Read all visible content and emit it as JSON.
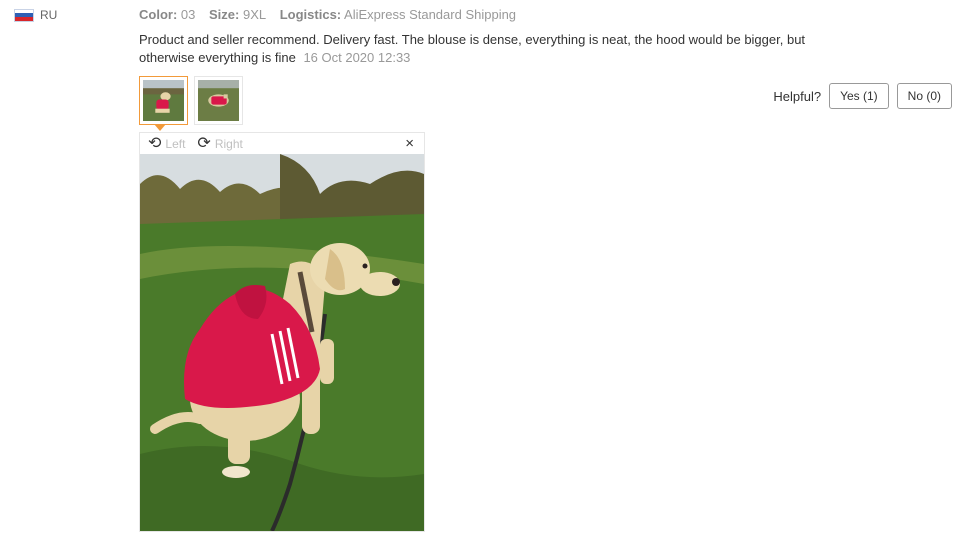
{
  "reviewer": {
    "country": "RU"
  },
  "attributes": [
    {
      "key": "Color:",
      "value": "03"
    },
    {
      "key": "Size:",
      "value": "9XL"
    },
    {
      "key": "Logistics:",
      "value": "AliExpress Standard Shipping"
    }
  ],
  "review": {
    "text": "Product and seller recommend. Delivery fast. The blouse is dense, everything is neat, the hood would be bigger, but otherwise everything is fine",
    "date": "16 Oct 2020 12:33"
  },
  "helpful": {
    "label": "Helpful?",
    "yes": "Yes (1)",
    "no": "No (0)"
  },
  "viewer": {
    "rotate_left": "Left",
    "rotate_right": "Right",
    "close": "×"
  },
  "icons": {
    "flag": "russia-flag-icon",
    "rotate_left": "rotate-left-icon",
    "rotate_right": "rotate-right-icon",
    "close": "close-icon"
  },
  "colors": {
    "accent": "#f29a3a",
    "text": "#333333",
    "muted": "#999999",
    "hoodie": "#d9184a"
  }
}
